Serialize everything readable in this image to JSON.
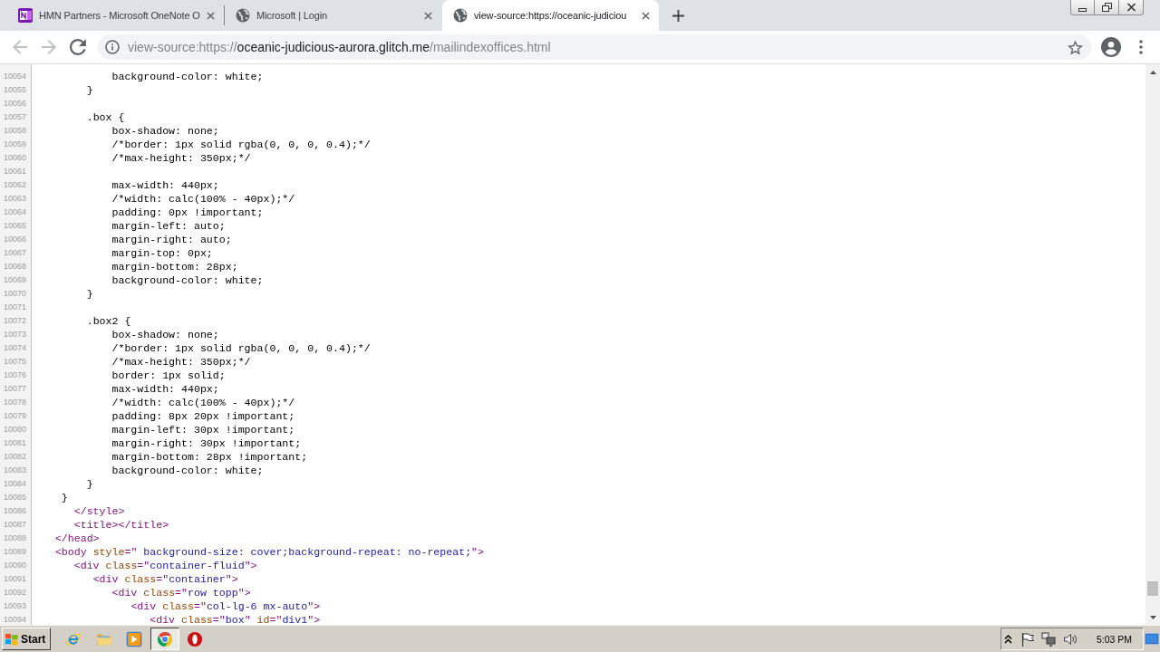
{
  "tabs": [
    {
      "kind": "note",
      "title": "HMN Partners - Microsoft OneNote O",
      "selected": false
    },
    {
      "kind": "globe",
      "title": "Microsoft | Login",
      "selected": false
    },
    {
      "kind": "globe",
      "title": "view-source:https://oceanic-judiciou",
      "selected": true
    }
  ],
  "toolbar": {
    "back": {
      "disabled": true
    },
    "forward": {
      "disabled": true
    },
    "address": {
      "scheme": "view-source:https://",
      "host": "oceanic-judicious-aurora.glitch.me",
      "path": "/mailindexoffices.html"
    }
  },
  "source": {
    "lines": [
      {
        "number": "10054",
        "tokens": [
          {
            "kind": "text",
            "text": "            background-color: white;"
          }
        ]
      },
      {
        "number": "10055",
        "tokens": [
          {
            "kind": "text",
            "text": "        }"
          }
        ]
      },
      {
        "number": "10056"
      },
      {
        "number": "10057",
        "tokens": [
          {
            "kind": "text",
            "text": "        .box {"
          }
        ]
      },
      {
        "number": "10058",
        "tokens": [
          {
            "kind": "text",
            "text": "            box-shadow: none;"
          }
        ]
      },
      {
        "number": "10059",
        "tokens": [
          {
            "kind": "text",
            "text": "            /*border: 1px solid rgba(0, 0, 0, 0.4);*/"
          }
        ]
      },
      {
        "number": "10060",
        "tokens": [
          {
            "kind": "text",
            "text": "            /*max-height: 350px;*/"
          }
        ]
      },
      {
        "number": "10061"
      },
      {
        "number": "10062",
        "tokens": [
          {
            "kind": "text",
            "text": "            max-width: 440px;"
          }
        ]
      },
      {
        "number": "10063",
        "tokens": [
          {
            "kind": "text",
            "text": "            /*width: calc(100% - 40px);*/"
          }
        ]
      },
      {
        "number": "10064",
        "tokens": [
          {
            "kind": "text",
            "text": "            padding: 0px !important;"
          }
        ]
      },
      {
        "number": "10065",
        "tokens": [
          {
            "kind": "text",
            "text": "            margin-left: auto;"
          }
        ]
      },
      {
        "number": "10066",
        "tokens": [
          {
            "kind": "text",
            "text": "            margin-right: auto;"
          }
        ]
      },
      {
        "number": "10067",
        "tokens": [
          {
            "kind": "text",
            "text": "            margin-top: 0px;"
          }
        ]
      },
      {
        "number": "10068",
        "tokens": [
          {
            "kind": "text",
            "text": "            margin-bottom: 28px;"
          }
        ]
      },
      {
        "number": "10069",
        "tokens": [
          {
            "kind": "text",
            "text": "            background-color: white;"
          }
        ]
      },
      {
        "number": "10070",
        "tokens": [
          {
            "kind": "text",
            "text": "        }"
          }
        ]
      },
      {
        "number": "10071"
      },
      {
        "number": "10072",
        "tokens": [
          {
            "kind": "text",
            "text": "        .box2 {"
          }
        ]
      },
      {
        "number": "10073",
        "tokens": [
          {
            "kind": "text",
            "text": "            box-shadow: none;"
          }
        ]
      },
      {
        "number": "10074",
        "tokens": [
          {
            "kind": "text",
            "text": "            /*border: 1px solid rgba(0, 0, 0, 0.4);*/"
          }
        ]
      },
      {
        "number": "10075",
        "tokens": [
          {
            "kind": "text",
            "text": "            /*max-height: 350px;*/"
          }
        ]
      },
      {
        "number": "10076",
        "tokens": [
          {
            "kind": "text",
            "text": "            border: 1px solid;"
          }
        ]
      },
      {
        "number": "10077",
        "tokens": [
          {
            "kind": "text",
            "text": "            max-width: 440px;"
          }
        ]
      },
      {
        "number": "10078",
        "tokens": [
          {
            "kind": "text",
            "text": "            /*width: calc(100% - 40px);*/"
          }
        ]
      },
      {
        "number": "10079",
        "tokens": [
          {
            "kind": "text",
            "text": "            padding: 8px 20px !important;"
          }
        ]
      },
      {
        "number": "10080",
        "tokens": [
          {
            "kind": "text",
            "text": "            margin-left: 30px !important;"
          }
        ]
      },
      {
        "number": "10081",
        "tokens": [
          {
            "kind": "text",
            "text": "            margin-right: 30px !important;"
          }
        ]
      },
      {
        "number": "10082",
        "tokens": [
          {
            "kind": "text",
            "text": "            margin-bottom: 28px !important;"
          }
        ]
      },
      {
        "number": "10083",
        "tokens": [
          {
            "kind": "text",
            "text": "            background-color: white;"
          }
        ]
      },
      {
        "number": "10084",
        "tokens": [
          {
            "kind": "text",
            "text": "        }"
          }
        ]
      },
      {
        "number": "10085",
        "tokens": [
          {
            "kind": "text",
            "text": "    }"
          }
        ]
      },
      {
        "number": "10086",
        "tokens": [
          {
            "kind": "tag",
            "text": "      </style>"
          }
        ]
      },
      {
        "number": "10087",
        "tokens": [
          {
            "kind": "tag",
            "text": "      <title></title>"
          }
        ]
      },
      {
        "number": "10088",
        "tokens": [
          {
            "kind": "tag",
            "text": "   </head>"
          }
        ]
      },
      {
        "number": "10089",
        "tokens": [
          {
            "kind": "tag",
            "text": "   <body "
          },
          {
            "kind": "attr",
            "text": "style"
          },
          {
            "kind": "tag",
            "text": "=\""
          },
          {
            "kind": "value",
            "text": " background-size: cover;background-repeat: no-repeat;"
          },
          {
            "kind": "tag",
            "text": "\">"
          }
        ]
      },
      {
        "number": "10090",
        "tokens": [
          {
            "kind": "tag",
            "text": "      <div "
          },
          {
            "kind": "attr",
            "text": "class"
          },
          {
            "kind": "tag",
            "text": "=\""
          },
          {
            "kind": "value",
            "text": "container-fluid"
          },
          {
            "kind": "tag",
            "text": "\">"
          }
        ]
      },
      {
        "number": "10091",
        "tokens": [
          {
            "kind": "tag",
            "text": "         <div "
          },
          {
            "kind": "attr",
            "text": "class"
          },
          {
            "kind": "tag",
            "text": "=\""
          },
          {
            "kind": "value",
            "text": "container"
          },
          {
            "kind": "tag",
            "text": "\">"
          }
        ]
      },
      {
        "number": "10092",
        "tokens": [
          {
            "kind": "tag",
            "text": "            <div "
          },
          {
            "kind": "attr",
            "text": "class"
          },
          {
            "kind": "tag",
            "text": "=\""
          },
          {
            "kind": "value",
            "text": "row topp"
          },
          {
            "kind": "tag",
            "text": "\">"
          }
        ]
      },
      {
        "number": "10093",
        "tokens": [
          {
            "kind": "tag",
            "text": "               <div "
          },
          {
            "kind": "attr",
            "text": "class"
          },
          {
            "kind": "tag",
            "text": "=\""
          },
          {
            "kind": "value",
            "text": "col-lg-6 mx-auto"
          },
          {
            "kind": "tag",
            "text": "\">"
          }
        ]
      },
      {
        "number": "10094",
        "tokens": [
          {
            "kind": "tag",
            "text": "                  <div "
          },
          {
            "kind": "attr",
            "text": "class"
          },
          {
            "kind": "tag",
            "text": "=\""
          },
          {
            "kind": "value",
            "text": "box"
          },
          {
            "kind": "tag",
            "text": "\" "
          },
          {
            "kind": "attr",
            "text": "id"
          },
          {
            "kind": "tag",
            "text": "=\""
          },
          {
            "kind": "value",
            "text": "div1"
          },
          {
            "kind": "tag",
            "text": "\">"
          }
        ]
      }
    ]
  },
  "taskbar": {
    "start": "Start",
    "apps": [
      {
        "kind": "ie",
        "selected": false
      },
      {
        "kind": "folder",
        "selected": false
      },
      {
        "kind": "player",
        "selected": false
      },
      {
        "kind": "chrome",
        "selected": true
      },
      {
        "kind": "opera",
        "selected": false
      }
    ],
    "clock": "5:03 PM"
  }
}
